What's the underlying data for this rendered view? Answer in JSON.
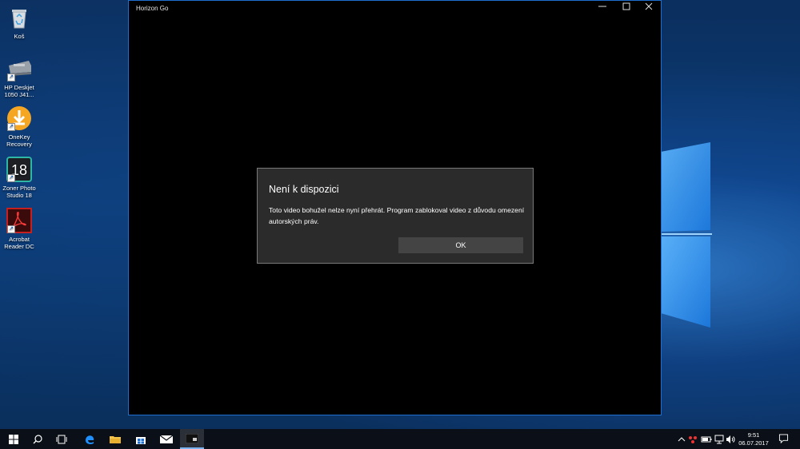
{
  "desktop": {
    "icons": [
      {
        "label": "Koš",
        "icon": "recycle-bin-icon"
      },
      {
        "label": "HP Deskjet 1050 J41...",
        "icon": "printer-icon"
      },
      {
        "label": "OneKey Recovery",
        "icon": "onekey-recovery-icon"
      },
      {
        "label": "Zoner Photo Studio 18",
        "icon": "zoner-photo-icon"
      },
      {
        "label": "Acrobat Reader DC",
        "icon": "acrobat-reader-icon"
      }
    ]
  },
  "window": {
    "title": "Horizon Go",
    "controls": [
      "minimize",
      "maximize",
      "close"
    ]
  },
  "dialog": {
    "title": "Není k dispozici",
    "message": "Toto video bohužel nelze nyní přehrát. Program zablokoval video z důvodu omezení autorských práv.",
    "ok_label": "OK"
  },
  "taskbar": {
    "items": [
      "start",
      "search",
      "task-view",
      "edge",
      "file-explorer",
      "store",
      "mail",
      "horizon-go"
    ],
    "clock_time": "9:51",
    "clock_date": "06.07.2017"
  },
  "colors": {
    "accent": "#1f6fd1",
    "dialog_bg": "#2b2b2b",
    "button_bg": "#444444"
  }
}
